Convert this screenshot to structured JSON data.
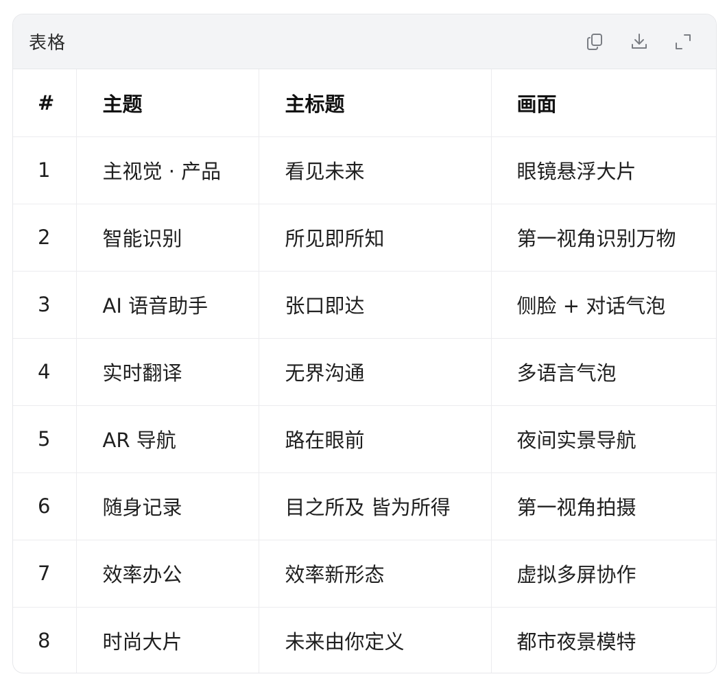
{
  "panel": {
    "title": "表格",
    "icons": [
      "copy-icon",
      "download-icon",
      "expand-icon"
    ]
  },
  "table": {
    "headers": [
      "#",
      "主题",
      "主标题",
      "画面"
    ],
    "rows": [
      [
        "1",
        "主视觉 · 产品",
        "看见未来",
        "眼镜悬浮大片"
      ],
      [
        "2",
        "智能识别",
        "所见即所知",
        "第一视角识别万物"
      ],
      [
        "3",
        "AI 语音助手",
        "张口即达",
        "侧脸 + 对话气泡"
      ],
      [
        "4",
        "实时翻译",
        "无界沟通",
        "多语言气泡"
      ],
      [
        "5",
        "AR 导航",
        "路在眼前",
        "夜间实景导航"
      ],
      [
        "6",
        "随身记录",
        "目之所及 皆为所得",
        "第一视角拍摄"
      ],
      [
        "7",
        "效率办公",
        "效率新形态",
        "虚拟多屏协作"
      ],
      [
        "8",
        "时尚大片",
        "未来由你定义",
        "都市夜景模特"
      ]
    ]
  }
}
